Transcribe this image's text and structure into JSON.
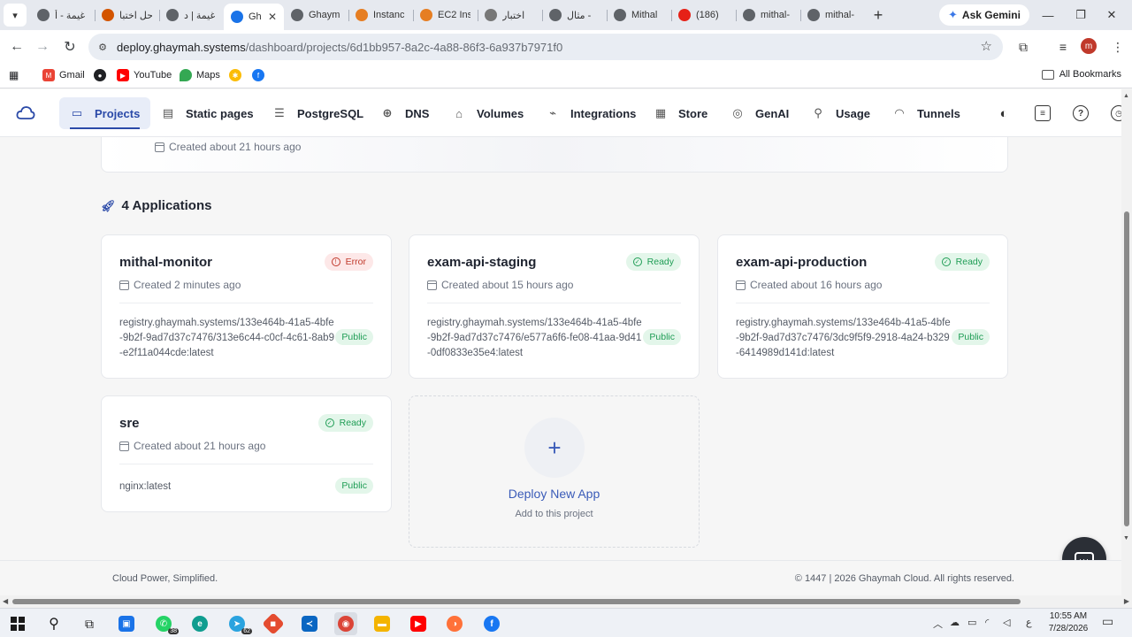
{
  "browser": {
    "tabs": [
      {
        "label": "غيمة - أ",
        "fav": "#5f6368",
        "active": false
      },
      {
        "label": "حل اختبا",
        "fav": "#d35400",
        "active": false
      },
      {
        "label": "غيمة | د",
        "fav": "#5f6368",
        "active": false
      },
      {
        "label": "Gh",
        "fav": "#1a73e8",
        "active": true
      },
      {
        "label": "Ghaym",
        "fav": "#5f6368",
        "active": false
      },
      {
        "label": "Instanc",
        "fav": "#e67e22",
        "active": false
      },
      {
        "label": "EC2 Ins",
        "fav": "#e67e22",
        "active": false
      },
      {
        "label": "اختبار",
        "fav": "#777777",
        "active": false
      },
      {
        "label": "مثال -",
        "fav": "#5f6368",
        "active": false
      },
      {
        "label": "Mithal",
        "fav": "#5f6368",
        "active": false
      },
      {
        "label": "(186)",
        "fav": "#e62117",
        "active": false
      },
      {
        "label": "mithal-",
        "fav": "#5f6368",
        "active": false
      },
      {
        "label": "mithal-",
        "fav": "#5f6368",
        "active": false
      }
    ],
    "active_tab_close": "✕",
    "new_tab": "+",
    "ask_gemini": "Ask Gemini",
    "url_host": "deploy.ghaymah.systems",
    "url_path": "/dashboard/projects/6d1bb957-8a2c-4a88-86f3-6a937b7971f0",
    "profile_initial": "m",
    "bookmarks": [
      {
        "label": "Gmail",
        "color": "#ea4335"
      },
      {
        "label": "",
        "color": "#202124"
      },
      {
        "label": "YouTube",
        "color": "#ff0000"
      },
      {
        "label": "Maps",
        "color": "#34a853"
      },
      {
        "label": "",
        "color": "#fbbc05"
      },
      {
        "label": "",
        "color": "#1877f2"
      }
    ],
    "all_bookmarks": "All Bookmarks"
  },
  "app": {
    "nav": [
      {
        "label": "Projects",
        "icon": "folder-icon",
        "active": true
      },
      {
        "label": "Static pages",
        "icon": "file-icon",
        "active": false
      },
      {
        "label": "PostgreSQL",
        "icon": "database-icon",
        "active": false
      },
      {
        "label": "DNS",
        "icon": "globe-icon",
        "active": false
      },
      {
        "label": "Volumes",
        "icon": "drive-icon",
        "active": false
      },
      {
        "label": "Integrations",
        "icon": "plug-icon",
        "active": false
      },
      {
        "label": "Store",
        "icon": "store-icon",
        "active": false
      },
      {
        "label": "GenAI",
        "icon": "brain-icon",
        "active": false
      },
      {
        "label": "Usage",
        "icon": "pin-icon",
        "active": false
      },
      {
        "label": "Tunnels",
        "icon": "tunnel-icon",
        "active": false
      }
    ],
    "project_created": "Created about 21 hours ago",
    "apps_heading": "4 Applications",
    "applications": [
      {
        "name": "mithal-monitor",
        "status": "Error",
        "status_type": "error",
        "created": "Created 2 minutes ago",
        "image": "registry.ghaymah.systems/133e464b-41a5-4bfe-9b2f-9ad7d37c7476/313e6c44-c0cf-4c61-8ab9-e2f11a044cde:latest",
        "visibility": "Public"
      },
      {
        "name": "exam-api-staging",
        "status": "Ready",
        "status_type": "ok",
        "created": "Created about 15 hours ago",
        "image": "registry.ghaymah.systems/133e464b-41a5-4bfe-9b2f-9ad7d37c7476/e577a6f6-fe08-41aa-9d41-0df0833e35e4:latest",
        "visibility": "Public"
      },
      {
        "name": "exam-api-production",
        "status": "Ready",
        "status_type": "ok",
        "created": "Created about 16 hours ago",
        "image": "registry.ghaymah.systems/133e464b-41a5-4bfe-9b2f-9ad7d37c7476/3dc9f5f9-2918-4a24-b329-6414989d141d:latest",
        "visibility": "Public"
      },
      {
        "name": "sre",
        "status": "Ready",
        "status_type": "ok",
        "created": "Created about 21 hours ago",
        "image": "nginx:latest",
        "visibility": "Public"
      }
    ],
    "deploy": {
      "title": "Deploy New App",
      "subtitle": "Add to this project"
    },
    "footer_left": "Cloud Power, Simplified.",
    "footer_right": "© 1447 | 2026 Ghaymah Cloud. All rights reserved."
  },
  "taskbar": {
    "whatsapp_count": "38",
    "telegram_count": "62",
    "lang": "ع",
    "time": "10:55 AM",
    "date": "7/28/2026"
  }
}
